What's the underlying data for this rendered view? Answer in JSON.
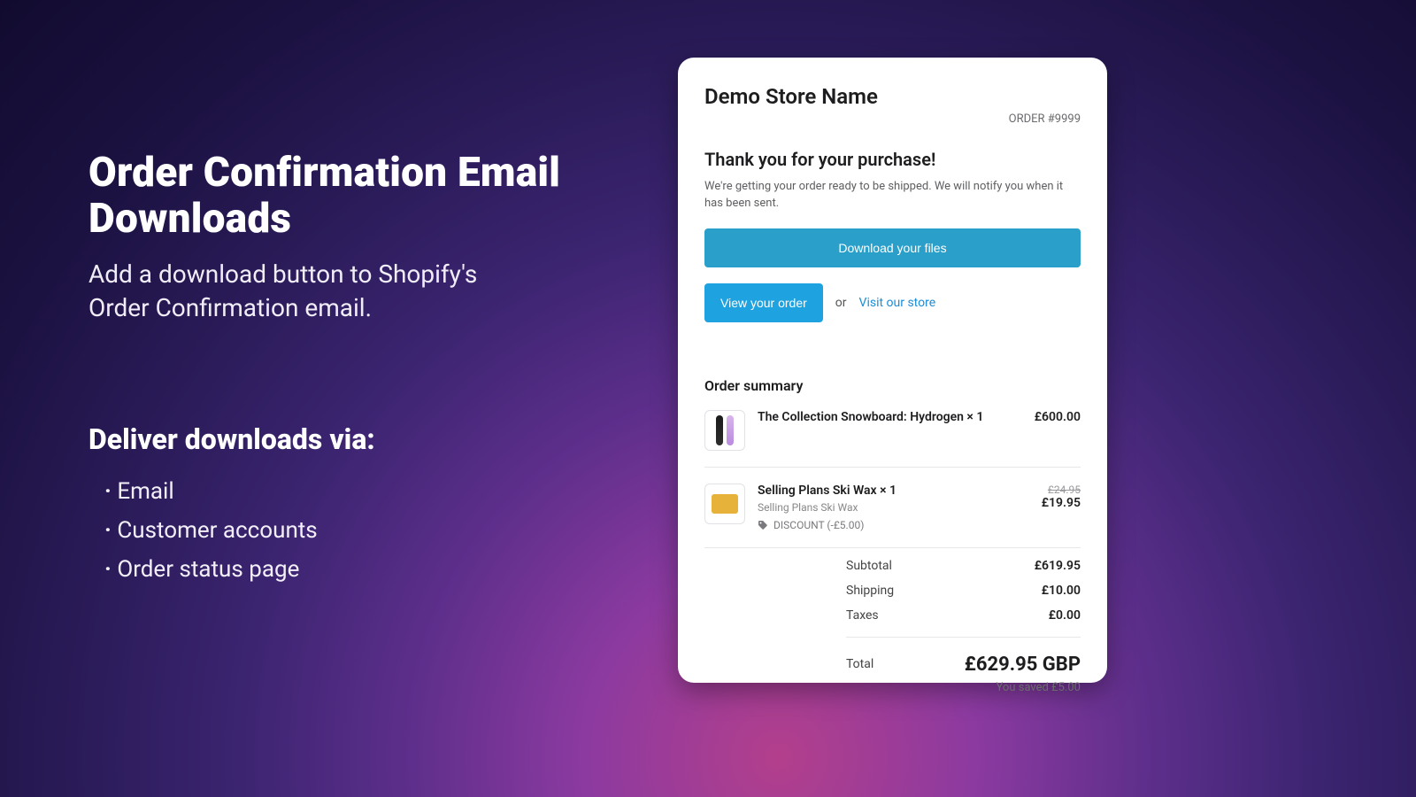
{
  "marketing": {
    "headline_line1": "Order Confirmation Email",
    "headline_line2": "Downloads",
    "sub_line1": "Add a download button to Shopify's",
    "sub_line2": "Order Confirmation email.",
    "deliver_heading": "Deliver downloads via:",
    "bullets": [
      "Email",
      "Customer accounts",
      "Order status page"
    ]
  },
  "email": {
    "store_name": "Demo Store Name",
    "order_number": "ORDER #9999",
    "thank_you": "Thank you for your purchase!",
    "shipping_msg": "We're getting your order ready to be shipped. We will notify you when it has been sent.",
    "download_btn": "Download your files",
    "view_order_btn": "View your order",
    "or_text": "or",
    "visit_link": "Visit our store",
    "summary_heading": "Order summary",
    "items": [
      {
        "title": "The Collection Snowboard: Hydrogen × 1",
        "price": "£600.00"
      },
      {
        "title": "Selling Plans Ski Wax × 1",
        "subtitle": "Selling Plans Ski Wax",
        "discount_label": "DISCOUNT (-£5.00)",
        "price_strike": "£24.95",
        "price": "£19.95"
      }
    ],
    "subtotal_label": "Subtotal",
    "subtotal": "£619.95",
    "shipping_label": "Shipping",
    "shipping": "£10.00",
    "taxes_label": "Taxes",
    "taxes": "£0.00",
    "total_label": "Total",
    "total": "£629.95 GBP",
    "saved": "You saved £5.00"
  }
}
